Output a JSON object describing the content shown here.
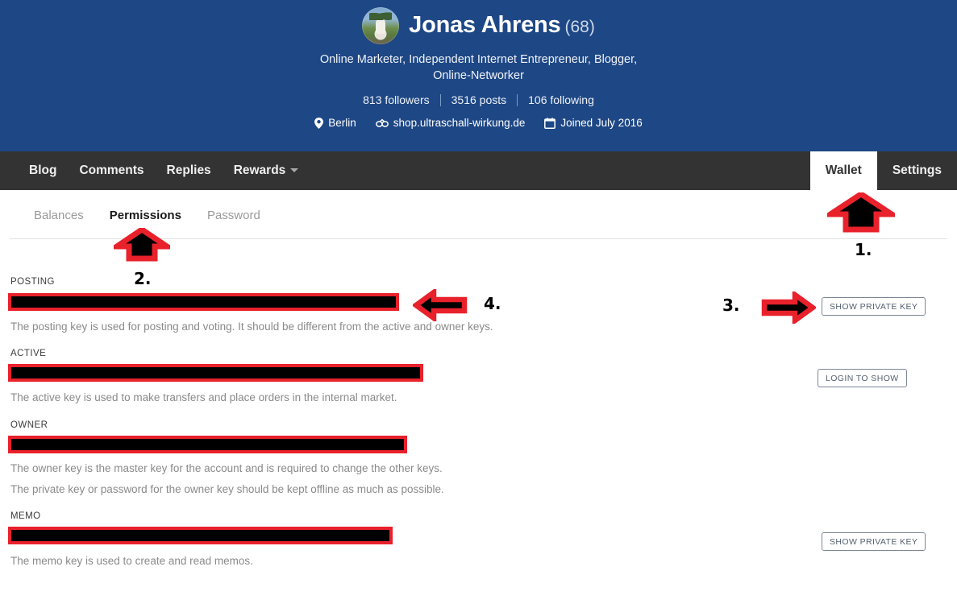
{
  "profile": {
    "avatar_alt": "user-avatar",
    "display_name": "Jonas Ahrens",
    "reputation": "(68)",
    "about": "Online Marketer, Independent Internet Entrepreneur, Blogger, Online-Networker",
    "followers": "813 followers",
    "posts": "3516 posts",
    "following": "106 following",
    "location": "Berlin",
    "website": "shop.ultraschall-wirkung.de",
    "joined": "Joined July 2016",
    "header_bg": "#1e4785"
  },
  "main_nav": {
    "left_items": [
      {
        "label": "Blog",
        "has_caret": false
      },
      {
        "label": "Comments",
        "has_caret": false
      },
      {
        "label": "Replies",
        "has_caret": false
      },
      {
        "label": "Rewards",
        "has_caret": true
      }
    ],
    "right_items": [
      {
        "label": "Wallet",
        "active": true
      },
      {
        "label": "Settings",
        "active": false
      }
    ],
    "nav_bg": "#333333"
  },
  "subtabs": [
    {
      "label": "Balances",
      "active": false
    },
    {
      "label": "Permissions",
      "active": true
    },
    {
      "label": "Password",
      "active": false
    }
  ],
  "keys": [
    {
      "label": "POSTING",
      "value_redacted": true,
      "descriptions": [
        "The posting key is used for posting and voting. It should be different from the active and owner keys."
      ],
      "button": "SHOW PRIVATE KEY"
    },
    {
      "label": "ACTIVE",
      "value_redacted": true,
      "descriptions": [
        "The active key is used to make transfers and place orders in the internal market."
      ],
      "button": "LOGIN TO SHOW"
    },
    {
      "label": "OWNER",
      "value_redacted": true,
      "descriptions": [
        "The owner key is the master key for the account and is required to change the other keys.",
        "The private key or password for the owner key should be kept offline as much as possible."
      ],
      "button": null
    },
    {
      "label": "MEMO",
      "value_redacted": true,
      "descriptions": [
        "The memo key is used to create and read memos."
      ],
      "button": "SHOW PRIVATE KEY"
    }
  ],
  "annotations": [
    {
      "number": "1.",
      "direction": "up",
      "target": "wallet-tab"
    },
    {
      "number": "2.",
      "direction": "up",
      "target": "permissions-subtab"
    },
    {
      "number": "3.",
      "direction": "right",
      "target": "posting-show-private-key-button"
    },
    {
      "number": "4.",
      "direction": "left",
      "target": "posting-key-field"
    }
  ],
  "annotation_style": {
    "fill": "#000000",
    "outline": "#e8212b"
  }
}
